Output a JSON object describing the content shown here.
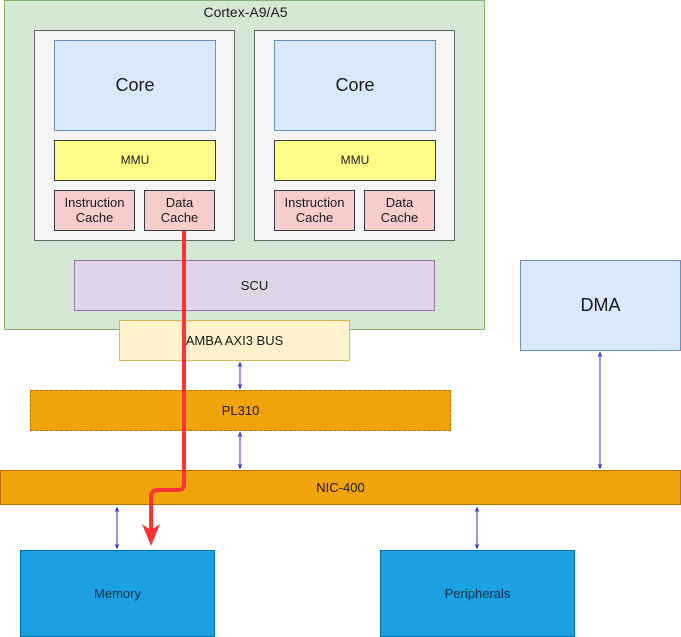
{
  "diagram": {
    "cluster": {
      "title": "Cortex-A9/A5"
    },
    "cpus": [
      {
        "core": "Core",
        "mmu": "MMU",
        "icache": "Instruction\nCache",
        "dcache": "Data\nCache"
      },
      {
        "core": "Core",
        "mmu": "MMU",
        "icache": "Instruction\nCache",
        "dcache": "Data\nCache"
      }
    ],
    "scu": "SCU",
    "amba": "AMBA AXI3 BUS",
    "pl310": "PL310",
    "nic": "NIC-400",
    "dma": "DMA",
    "memory": "Memory",
    "peripherals": "Peripherals",
    "connections": [
      {
        "from": "AMBA AXI3 BUS",
        "to": "PL310",
        "type": "bidirectional"
      },
      {
        "from": "PL310",
        "to": "NIC-400",
        "type": "bidirectional"
      },
      {
        "from": "DMA",
        "to": "NIC-400",
        "type": "bidirectional"
      },
      {
        "from": "NIC-400",
        "to": "Memory",
        "type": "bidirectional"
      },
      {
        "from": "NIC-400",
        "to": "Peripherals",
        "type": "bidirectional"
      },
      {
        "from": "Data Cache",
        "to": "Memory",
        "type": "highlight-path"
      }
    ],
    "colors": {
      "bus_arrow": "#3333dd",
      "highlight_path": "#ff3333"
    }
  }
}
